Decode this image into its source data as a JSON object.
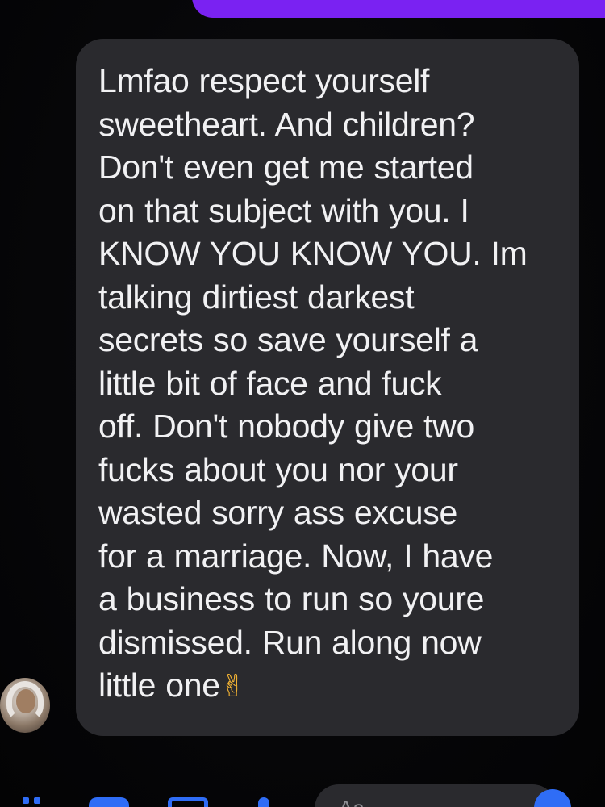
{
  "conversation": {
    "received_message": {
      "lines": [
        "Lmfao respect yourself",
        "sweetheart. And children?",
        "Don't even get me started",
        "on that subject with you. I",
        "KNOW YOU KNOW YOU. Im",
        "talking dirtiest darkest",
        "secrets so save yourself a",
        "little bit of face and fuck",
        "off. Don't nobody give two",
        "fucks about you nor your",
        "wasted sorry ass excuse",
        "for a marriage. Now, I have",
        "a business to run so youre",
        "dismissed. Run along now",
        "little one"
      ],
      "emoji": "✌",
      "emoji_name": "victory-hand-emoji"
    },
    "sender_avatar": "profile-photo",
    "colors": {
      "sent_bubble": "#7a22f2",
      "received_bubble": "#2a2a2e",
      "text": "#f1f1f3",
      "accent": "#2f6df6",
      "background": "#050507"
    }
  },
  "composer": {
    "placeholder": "Aa",
    "icons": [
      "apps-icon",
      "camera-icon",
      "gallery-icon",
      "microphone-icon",
      "emoji-icon"
    ]
  }
}
